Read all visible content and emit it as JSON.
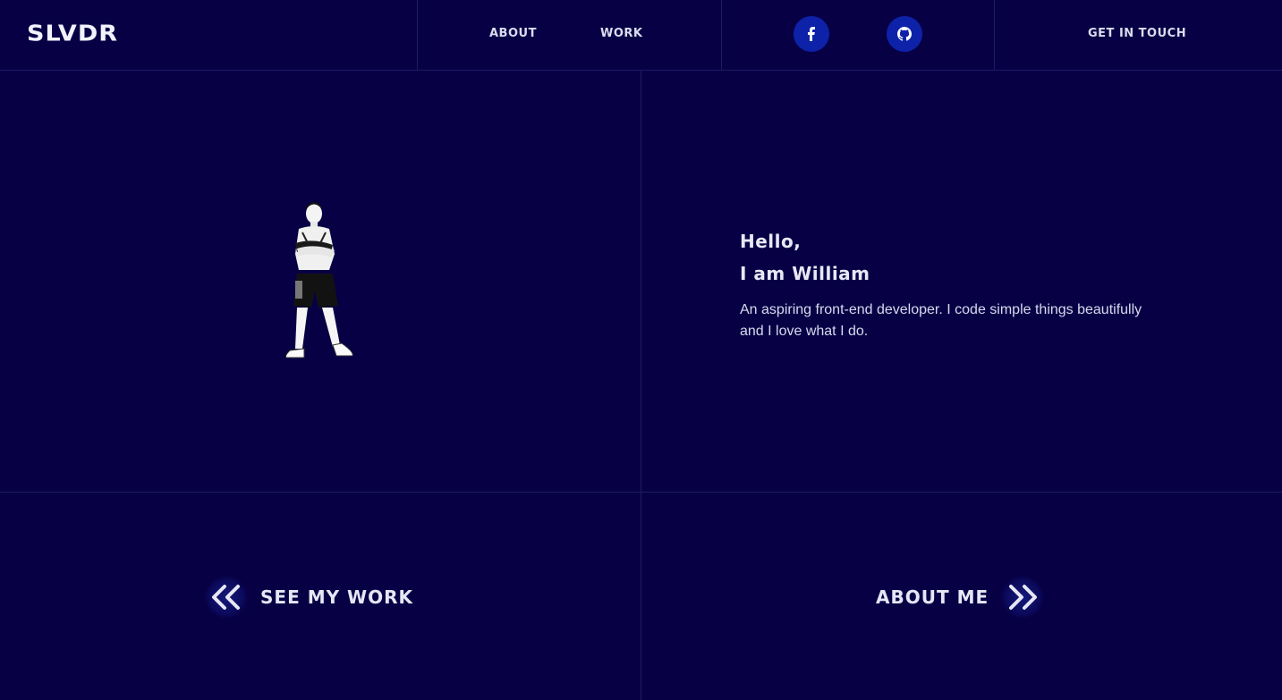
{
  "brand": {
    "logo": "SLVDR"
  },
  "nav": {
    "about": "ABOUT",
    "work": "WORK",
    "contact": "GET IN TOUCH"
  },
  "social": [
    {
      "name": "facebook-icon"
    },
    {
      "name": "github-icon"
    }
  ],
  "hero": {
    "greeting_line1": "Hello,",
    "greeting_line2": "I am William",
    "intro": "An aspiring front-end developer. I code simple things beautifully and I love what I do."
  },
  "cta": {
    "work": "SEE MY WORK",
    "about": "ABOUT ME"
  },
  "colors": {
    "background": "#070045",
    "grid_line": "#1d1a66",
    "social_bg": "#0d22a8",
    "text": "#e6e6f2"
  }
}
